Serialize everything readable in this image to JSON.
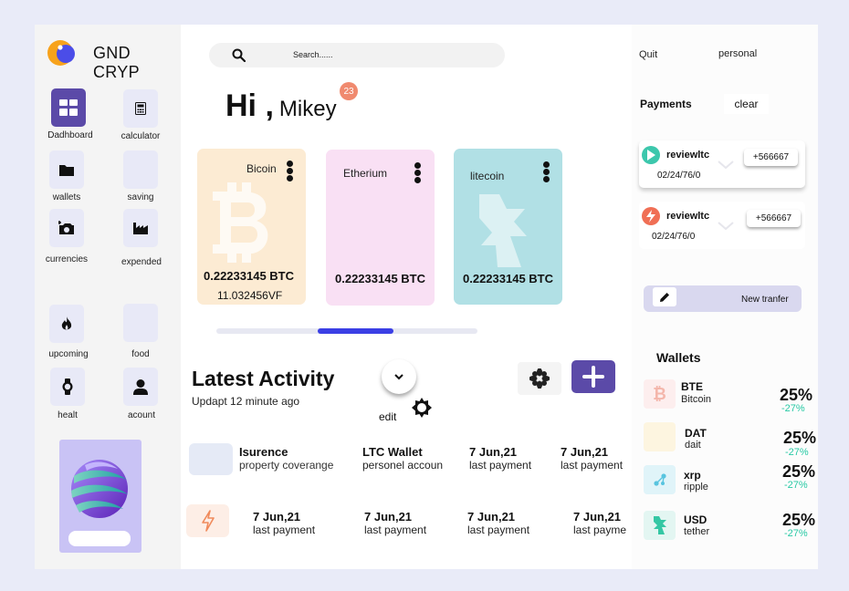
{
  "app": {
    "brand": "GND CRYP"
  },
  "colors": {
    "accent": "#5b4aa8",
    "scroll": "#3b3fe5",
    "positive": "#27c9a4",
    "notif": "#f08a6f"
  },
  "sidebar": {
    "items": [
      {
        "label": "Dadhboard",
        "icon": "dashboard-grid-icon",
        "active": true
      },
      {
        "label": "calculator",
        "icon": "calculator-icon"
      },
      {
        "label": "wallets",
        "icon": "folder-icon"
      },
      {
        "label": "saving",
        "icon": ""
      },
      {
        "label": "currencies",
        "icon": "add-camera-icon"
      },
      {
        "label": "expended",
        "icon": "factory-icon"
      },
      {
        "label": "upcoming",
        "icon": "flame-icon"
      },
      {
        "label": "food",
        "icon": ""
      },
      {
        "label": "healt",
        "icon": "watch-icon"
      },
      {
        "label": "acount",
        "icon": "user-icon"
      }
    ]
  },
  "search": {
    "placeholder": "Search......"
  },
  "greeting": {
    "hi": "Hi ,",
    "name": "Mikey",
    "notifications": "23"
  },
  "cards": [
    {
      "name": "Bicoin",
      "value": "0.22233145 BTC",
      "sub": "11.032456VF",
      "bg": "#fcebd3"
    },
    {
      "name": "Etherium",
      "value": "0.22233145 BTC",
      "bg": "#f9e0f4"
    },
    {
      "name": "litecoin",
      "value": "0.22233145 BTC",
      "bg": "#b1e0e5"
    }
  ],
  "activity": {
    "title": "Latest Activity",
    "updated": "Updapt 12 minute ago",
    "edit_label": "edit",
    "row1": {
      "name": "Isurence",
      "desc": "property coverange",
      "c2_title": "LTC Wallet",
      "c2_sub": "personel accoun",
      "c3_title": "7 Jun,21",
      "c3_sub": "last payment",
      "c4_title": "7 Jun,21",
      "c4_sub": "last payment"
    },
    "row2": [
      {
        "title": "7 Jun,21",
        "sub": "last payment"
      },
      {
        "title": "7 Jun,21",
        "sub": "last payment"
      },
      {
        "title": "7 Jun,21",
        "sub": "last payment"
      },
      {
        "title": "7 Jun,21",
        "sub": "last payme"
      }
    ]
  },
  "right": {
    "quit": "Quit",
    "personal": "personal",
    "payments_title": "Payments",
    "clear": "clear",
    "payments": [
      {
        "name": "reviewltc",
        "date": "02/24/76/0",
        "amount": "+566667",
        "icon_color": "#3cc7ac"
      },
      {
        "name": "reviewltc",
        "date": "02/24/76/0",
        "amount": "+566667",
        "icon_color": "#f06f55"
      }
    ],
    "transfer_label": "New tranfer",
    "wallets_title": "Wallets",
    "wallets": [
      {
        "code": "BTE",
        "name": "Bitcoin",
        "pct": "25%",
        "chg": "-27%"
      },
      {
        "code": "DAT",
        "name": "dait",
        "pct": "25%",
        "chg": "-27%"
      },
      {
        "code": "xrp",
        "name": "ripple",
        "pct": "25%",
        "chg": "-27%"
      },
      {
        "code": "USD",
        "name": "tether",
        "pct": "25%",
        "chg": "-27%"
      }
    ]
  }
}
